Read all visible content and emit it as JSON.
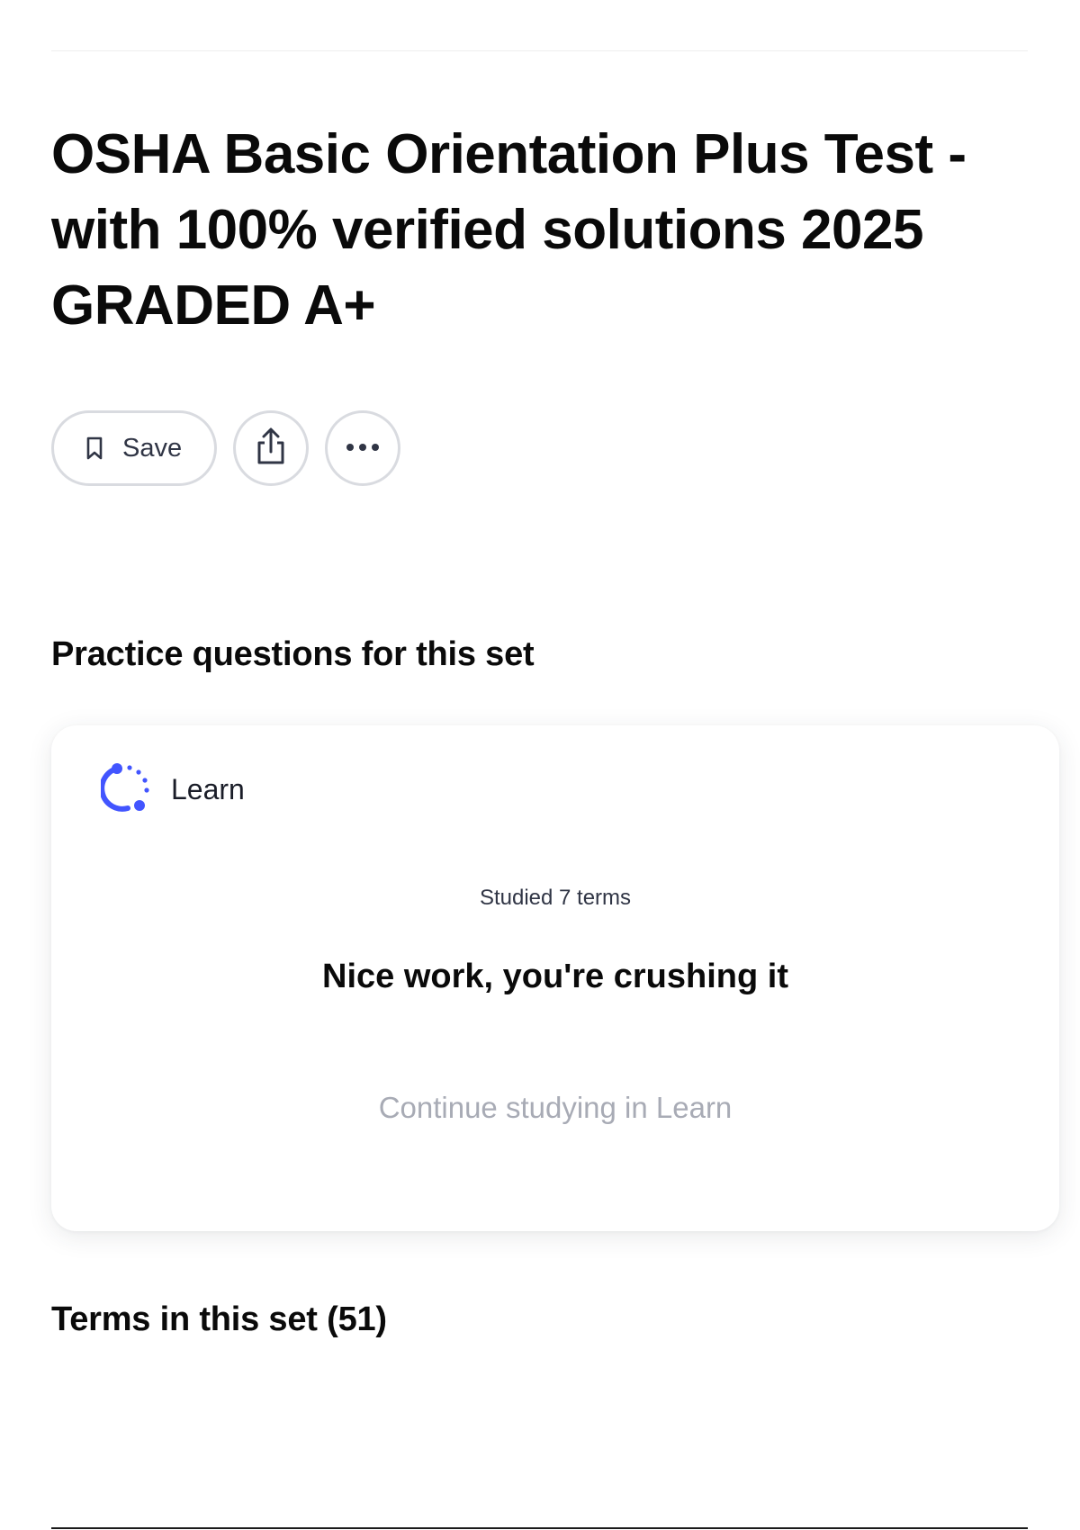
{
  "set": {
    "title": "OSHA Basic Orientation Plus Test - with 100% verified solutions 2025 GRADED A+"
  },
  "actions": {
    "save_label": "Save",
    "save_icon": "bookmark-icon",
    "share_icon": "share-icon",
    "more_icon": "more-horizontal-icon"
  },
  "practice": {
    "heading": "Practice questions for this set",
    "card": {
      "mode_label": "Learn",
      "mode_icon": "learn-progress-icon",
      "studied_text": "Studied 7 terms",
      "message": "Nice work, you're crushing it",
      "continue_label": "Continue studying in Learn"
    }
  },
  "terms": {
    "heading": "Terms in this set (51)"
  },
  "colors": {
    "accent": "#4255ff",
    "border": "#d9dbe0",
    "muted_text": "#a8abb5",
    "text": "#0a0a0a"
  }
}
